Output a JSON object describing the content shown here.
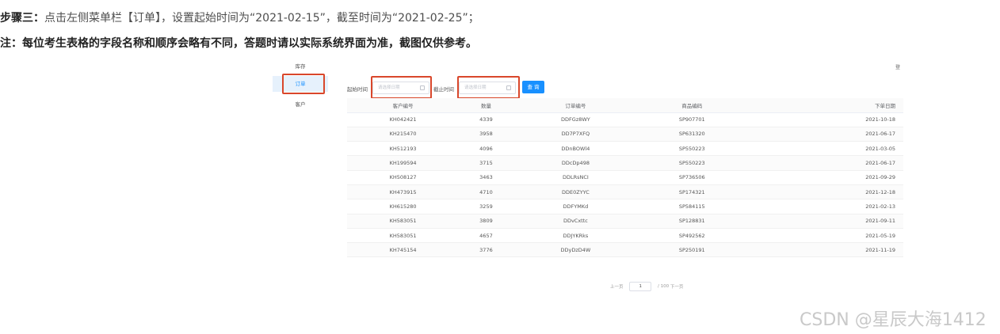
{
  "article": {
    "step_prefix": "步骤三：",
    "step_text": "点击左侧菜单栏【订单】，设置起始时间为“2021-02-15”，截至时间为“2021-02-25”；",
    "note": "注：每位考生表格的字段名称和顺序会略有不同，答题时请以实际系统界面为准，截图仅供参考。"
  },
  "sidebar": {
    "items": [
      {
        "label": "库存"
      },
      {
        "label": "订单"
      },
      {
        "label": "客户"
      }
    ],
    "active_index": 1
  },
  "header_right_glyph": "登",
  "filters": {
    "start_label": "起始时间",
    "start_placeholder": "请选择日期",
    "end_label": "截止时间",
    "end_placeholder": "请选择日期",
    "query_label": "查 询"
  },
  "table": {
    "columns": [
      "客户编号",
      "数量",
      "订单编号",
      "商品编码",
      "下单日期"
    ],
    "rows": [
      [
        "KH042421",
        "4339",
        "DDFGz8WY",
        "SP907701",
        "2021-10-18"
      ],
      [
        "KH215470",
        "3958",
        "DD7P7XFQ",
        "SP631320",
        "2021-06-17"
      ],
      [
        "KH512193",
        "4096",
        "DDnBOWl4",
        "SP550223",
        "2021-03-05"
      ],
      [
        "KH199594",
        "3715",
        "DDcDp498",
        "SP550223",
        "2021-06-17"
      ],
      [
        "KH508127",
        "3463",
        "DDLRsNCI",
        "SP736506",
        "2021-09-29"
      ],
      [
        "KH473915",
        "4710",
        "DDE0ZYYC",
        "SP174321",
        "2021-12-18"
      ],
      [
        "KH615280",
        "3259",
        "DDFYMKd",
        "SP584115",
        "2021-02-13"
      ],
      [
        "KH583051",
        "3809",
        "DDvCxttc",
        "SP128831",
        "2021-09-11"
      ],
      [
        "KH583051",
        "4657",
        "DDJYKRks",
        "SP492562",
        "2021-05-19"
      ],
      [
        "KH745154",
        "3776",
        "DDyDzD4W",
        "SP250191",
        "2021-11-19"
      ]
    ]
  },
  "pagination": {
    "prev": "上一页",
    "current_page": "1",
    "total": "/ 100",
    "next": "下一页"
  },
  "watermark": "CSDN @星辰大海1412",
  "colors": {
    "accent": "#1890ff",
    "highlight_border": "#d9472b",
    "active_bg": "#e6f1fc"
  }
}
